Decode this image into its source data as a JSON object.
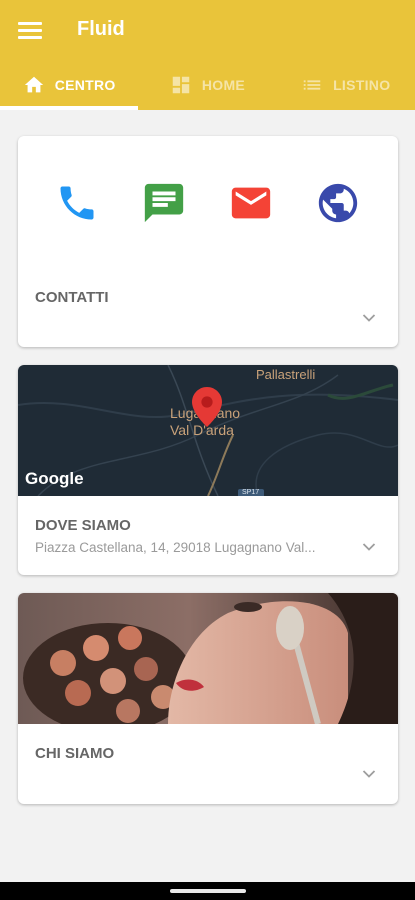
{
  "app": {
    "title": "Fluid",
    "accent": "#e9c43a"
  },
  "tabs": [
    {
      "label": "CENTRO",
      "icon": "home-icon",
      "active": true
    },
    {
      "label": "HOME",
      "icon": "dashboard-icon",
      "active": false
    },
    {
      "label": "LISTINO",
      "icon": "list-icon",
      "active": false
    }
  ],
  "contacts": {
    "title": "CONTATTI",
    "actions": [
      {
        "icon": "phone-icon",
        "color": "#2196f3"
      },
      {
        "icon": "message-icon",
        "color": "#43a047"
      },
      {
        "icon": "email-icon",
        "color": "#f44336"
      },
      {
        "icon": "globe-icon",
        "color": "#3949ab"
      }
    ]
  },
  "location": {
    "title": "DOVE SIAMO",
    "address": "Piazza Castellana, 14, 29018 Lugagnano Val...",
    "map_labels": {
      "place": "Lugagnano Val D'arda",
      "nearby": "Pallastrelli",
      "road": "SP17",
      "brand": "Google"
    }
  },
  "about": {
    "title": "CHI SIAMO"
  }
}
